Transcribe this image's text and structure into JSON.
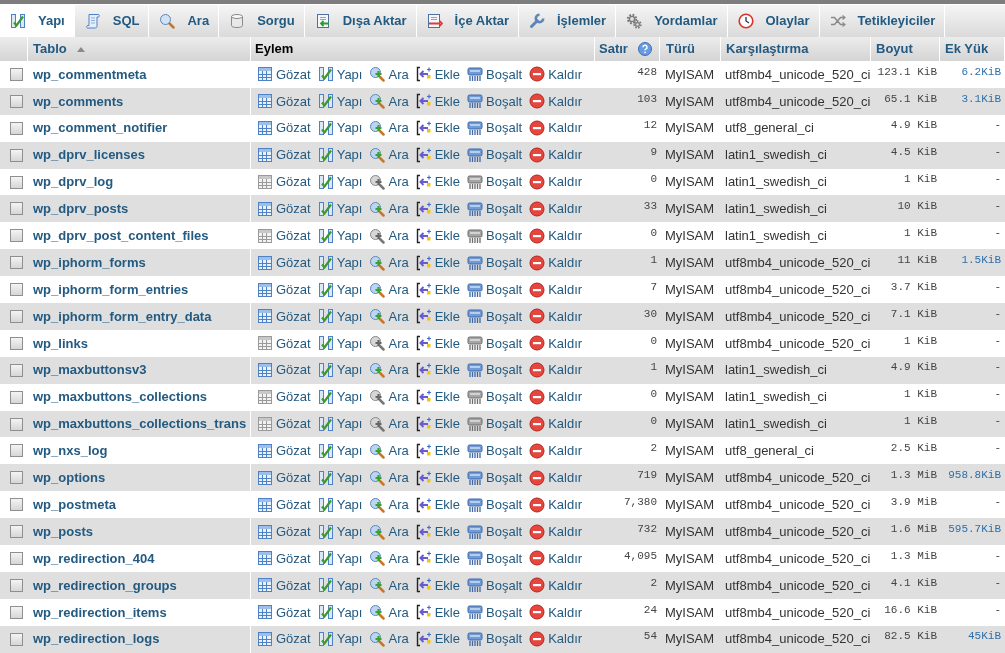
{
  "tabs": [
    {
      "label": "Yapı",
      "selected": true
    },
    {
      "label": "SQL",
      "selected": false
    },
    {
      "label": "Ara",
      "selected": false
    },
    {
      "label": "Sorgu",
      "selected": false
    },
    {
      "label": "Dışa Aktar",
      "selected": false
    },
    {
      "label": "İçe Aktar",
      "selected": false
    },
    {
      "label": "İşlemler",
      "selected": false
    },
    {
      "label": "Yordamlar",
      "selected": false
    },
    {
      "label": "Olaylar",
      "selected": false
    },
    {
      "label": "Tetikleyiciler",
      "selected": false
    }
  ],
  "table": {
    "columns": [
      {
        "label": "Tablo",
        "sortable": true,
        "sorted_ascending": true
      },
      {
        "label": "Eylem",
        "sortable": false
      },
      {
        "label": "Satır",
        "sortable": true,
        "help": true
      },
      {
        "label": "Türü",
        "sortable": true
      },
      {
        "label": "Karşılaştırma",
        "sortable": true
      },
      {
        "label": "Boyut",
        "sortable": true
      },
      {
        "label": "Ek Yük",
        "sortable": true
      }
    ],
    "rows": [
      {
        "checked": false,
        "name": "wp_commentmeta",
        "actions": [
          "Gözat",
          "Yapı",
          "Ara",
          "Ekle",
          "Boşalt",
          "Kaldır"
        ],
        "empty": false,
        "rows": "428",
        "engine": "MyISAM",
        "collation": "utf8mb4_unicode_520_ci",
        "size": "123.1 KiB",
        "overhead": "6.2KiB",
        "overhead_link": true
      },
      {
        "checked": false,
        "name": "wp_comments",
        "actions": [
          "Gözat",
          "Yapı",
          "Ara",
          "Ekle",
          "Boşalt",
          "Kaldır"
        ],
        "empty": false,
        "rows": "103",
        "engine": "MyISAM",
        "collation": "utf8mb4_unicode_520_ci",
        "size": "65.1 KiB",
        "overhead": "3.1KiB",
        "overhead_link": true
      },
      {
        "checked": false,
        "name": "wp_comment_notifier",
        "actions": [
          "Gözat",
          "Yapı",
          "Ara",
          "Ekle",
          "Boşalt",
          "Kaldır"
        ],
        "empty": false,
        "rows": "12",
        "engine": "MyISAM",
        "collation": "utf8_general_ci",
        "size": "4.9 KiB",
        "overhead": "-",
        "overhead_link": false
      },
      {
        "checked": false,
        "name": "wp_dprv_licenses",
        "actions": [
          "Gözat",
          "Yapı",
          "Ara",
          "Ekle",
          "Boşalt",
          "Kaldır"
        ],
        "empty": false,
        "rows": "9",
        "engine": "MyISAM",
        "collation": "latin1_swedish_ci",
        "size": "4.5 KiB",
        "overhead": "-",
        "overhead_link": false
      },
      {
        "checked": false,
        "name": "wp_dprv_log",
        "actions": [
          "Gözat",
          "Yapı",
          "Ara",
          "Ekle",
          "Boşalt",
          "Kaldır"
        ],
        "empty": true,
        "rows": "0",
        "engine": "MyISAM",
        "collation": "latin1_swedish_ci",
        "size": "1 KiB",
        "overhead": "-",
        "overhead_link": false
      },
      {
        "checked": false,
        "name": "wp_dprv_posts",
        "actions": [
          "Gözat",
          "Yapı",
          "Ara",
          "Ekle",
          "Boşalt",
          "Kaldır"
        ],
        "empty": false,
        "rows": "33",
        "engine": "MyISAM",
        "collation": "latin1_swedish_ci",
        "size": "10 KiB",
        "overhead": "-",
        "overhead_link": false
      },
      {
        "checked": false,
        "name": "wp_dprv_post_content_files",
        "actions": [
          "Gözat",
          "Yapı",
          "Ara",
          "Ekle",
          "Boşalt",
          "Kaldır"
        ],
        "empty": true,
        "rows": "0",
        "engine": "MyISAM",
        "collation": "latin1_swedish_ci",
        "size": "1 KiB",
        "overhead": "-",
        "overhead_link": false
      },
      {
        "checked": false,
        "name": "wp_iphorm_forms",
        "actions": [
          "Gözat",
          "Yapı",
          "Ara",
          "Ekle",
          "Boşalt",
          "Kaldır"
        ],
        "empty": false,
        "rows": "1",
        "engine": "MyISAM",
        "collation": "utf8mb4_unicode_520_ci",
        "size": "11 KiB",
        "overhead": "1.5KiB",
        "overhead_link": true
      },
      {
        "checked": false,
        "name": "wp_iphorm_form_entries",
        "actions": [
          "Gözat",
          "Yapı",
          "Ara",
          "Ekle",
          "Boşalt",
          "Kaldır"
        ],
        "empty": false,
        "rows": "7",
        "engine": "MyISAM",
        "collation": "utf8mb4_unicode_520_ci",
        "size": "3.7 KiB",
        "overhead": "-",
        "overhead_link": false
      },
      {
        "checked": false,
        "name": "wp_iphorm_form_entry_data",
        "actions": [
          "Gözat",
          "Yapı",
          "Ara",
          "Ekle",
          "Boşalt",
          "Kaldır"
        ],
        "empty": false,
        "rows": "30",
        "engine": "MyISAM",
        "collation": "utf8mb4_unicode_520_ci",
        "size": "7.1 KiB",
        "overhead": "-",
        "overhead_link": false
      },
      {
        "checked": false,
        "name": "wp_links",
        "actions": [
          "Gözat",
          "Yapı",
          "Ara",
          "Ekle",
          "Boşalt",
          "Kaldır"
        ],
        "empty": true,
        "rows": "0",
        "engine": "MyISAM",
        "collation": "utf8mb4_unicode_520_ci",
        "size": "1 KiB",
        "overhead": "-",
        "overhead_link": false
      },
      {
        "checked": false,
        "name": "wp_maxbuttonsv3",
        "actions": [
          "Gözat",
          "Yapı",
          "Ara",
          "Ekle",
          "Boşalt",
          "Kaldır"
        ],
        "empty": false,
        "rows": "1",
        "engine": "MyISAM",
        "collation": "latin1_swedish_ci",
        "size": "4.9 KiB",
        "overhead": "-",
        "overhead_link": false
      },
      {
        "checked": false,
        "name": "wp_maxbuttons_collections",
        "actions": [
          "Gözat",
          "Yapı",
          "Ara",
          "Ekle",
          "Boşalt",
          "Kaldır"
        ],
        "empty": true,
        "rows": "0",
        "engine": "MyISAM",
        "collation": "latin1_swedish_ci",
        "size": "1 KiB",
        "overhead": "-",
        "overhead_link": false
      },
      {
        "checked": false,
        "name": "wp_maxbuttons_collections_trans",
        "actions": [
          "Gözat",
          "Yapı",
          "Ara",
          "Ekle",
          "Boşalt",
          "Kaldır"
        ],
        "empty": true,
        "rows": "0",
        "engine": "MyISAM",
        "collation": "latin1_swedish_ci",
        "size": "1 KiB",
        "overhead": "-",
        "overhead_link": false
      },
      {
        "checked": false,
        "name": "wp_nxs_log",
        "actions": [
          "Gözat",
          "Yapı",
          "Ara",
          "Ekle",
          "Boşalt",
          "Kaldır"
        ],
        "empty": false,
        "rows": "2",
        "engine": "MyISAM",
        "collation": "utf8_general_ci",
        "size": "2.5 KiB",
        "overhead": "-",
        "overhead_link": false
      },
      {
        "checked": false,
        "name": "wp_options",
        "actions": [
          "Gözat",
          "Yapı",
          "Ara",
          "Ekle",
          "Boşalt",
          "Kaldır"
        ],
        "empty": false,
        "rows": "719",
        "engine": "MyISAM",
        "collation": "utf8mb4_unicode_520_ci",
        "size": "1.3 MiB",
        "overhead": "958.8KiB",
        "overhead_link": true
      },
      {
        "checked": false,
        "name": "wp_postmeta",
        "actions": [
          "Gözat",
          "Yapı",
          "Ara",
          "Ekle",
          "Boşalt",
          "Kaldır"
        ],
        "empty": false,
        "rows": "7,380",
        "engine": "MyISAM",
        "collation": "utf8mb4_unicode_520_ci",
        "size": "3.9 MiB",
        "overhead": "-",
        "overhead_link": false
      },
      {
        "checked": false,
        "name": "wp_posts",
        "actions": [
          "Gözat",
          "Yapı",
          "Ara",
          "Ekle",
          "Boşalt",
          "Kaldır"
        ],
        "empty": false,
        "rows": "732",
        "engine": "MyISAM",
        "collation": "utf8mb4_unicode_520_ci",
        "size": "1.6 MiB",
        "overhead": "595.7KiB",
        "overhead_link": true
      },
      {
        "checked": false,
        "name": "wp_redirection_404",
        "actions": [
          "Gözat",
          "Yapı",
          "Ara",
          "Ekle",
          "Boşalt",
          "Kaldır"
        ],
        "empty": false,
        "rows": "4,095",
        "engine": "MyISAM",
        "collation": "utf8mb4_unicode_520_ci",
        "size": "1.3 MiB",
        "overhead": "-",
        "overhead_link": false
      },
      {
        "checked": false,
        "name": "wp_redirection_groups",
        "actions": [
          "Gözat",
          "Yapı",
          "Ara",
          "Ekle",
          "Boşalt",
          "Kaldır"
        ],
        "empty": false,
        "rows": "2",
        "engine": "MyISAM",
        "collation": "utf8mb4_unicode_520_ci",
        "size": "4.1 KiB",
        "overhead": "-",
        "overhead_link": false
      },
      {
        "checked": false,
        "name": "wp_redirection_items",
        "actions": [
          "Gözat",
          "Yapı",
          "Ara",
          "Ekle",
          "Boşalt",
          "Kaldır"
        ],
        "empty": false,
        "rows": "24",
        "engine": "MyISAM",
        "collation": "utf8mb4_unicode_520_ci",
        "size": "16.6 KiB",
        "overhead": "-",
        "overhead_link": false
      },
      {
        "checked": false,
        "name": "wp_redirection_logs",
        "actions": [
          "Gözat",
          "Yapı",
          "Ara",
          "Ekle",
          "Boşalt",
          "Kaldır"
        ],
        "empty": false,
        "rows": "54",
        "engine": "MyISAM",
        "collation": "utf8mb4_unicode_520_ci",
        "size": "82.5 KiB",
        "overhead": "45KiB",
        "overhead_link": true
      }
    ]
  }
}
